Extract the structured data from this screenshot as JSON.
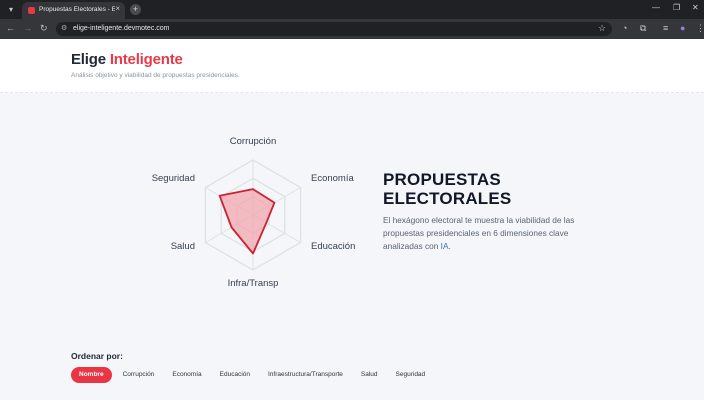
{
  "browser": {
    "tab_title": "Propuestas Electorales - Elige I",
    "tab_close": "×",
    "new_tab": "+",
    "url": "elige-inteligente.devmotec.com"
  },
  "header": {
    "brand_part1": "Elige",
    "brand_part2": "Inteligente",
    "tagline": "Análisis objetivo y viabilidad de propuestas presidenciales."
  },
  "radar": {
    "labels": {
      "corrupcion": "Corrupción",
      "economia": "Economía",
      "educacion": "Educación",
      "infra": "Infra/Transp",
      "salud": "Salud",
      "seguridad": "Seguridad"
    },
    "colors": {
      "fill": "#f2a5ad",
      "stroke": "#cc2333",
      "grid": "#dbe3e3"
    }
  },
  "hero": {
    "title_line1": "PROPUESTAS",
    "title_line2": "ELECTORALES",
    "desc_main": "El hexágono electoral te muestra la viabilidad de las propuestas presidenciales en 6 dimensiones clave analizadas con ",
    "desc_link": "IA",
    "desc_end": "."
  },
  "sort": {
    "label": "Ordenar por:",
    "options": [
      "Nombre",
      "Corrupción",
      "Economía",
      "Educación",
      "Infraestructura/Transporte",
      "Salud",
      "Seguridad"
    ]
  },
  "chart_data": {
    "type": "radar",
    "axes": [
      "Corrupción",
      "Economía",
      "Educación",
      "Infra/Transp",
      "Salud",
      "Seguridad"
    ],
    "series": [
      {
        "values": [
          0.47,
          0.45,
          0.28,
          0.7,
          0.45,
          0.7
        ]
      }
    ],
    "range": [
      0,
      1
    ],
    "grid_levels": 3
  }
}
